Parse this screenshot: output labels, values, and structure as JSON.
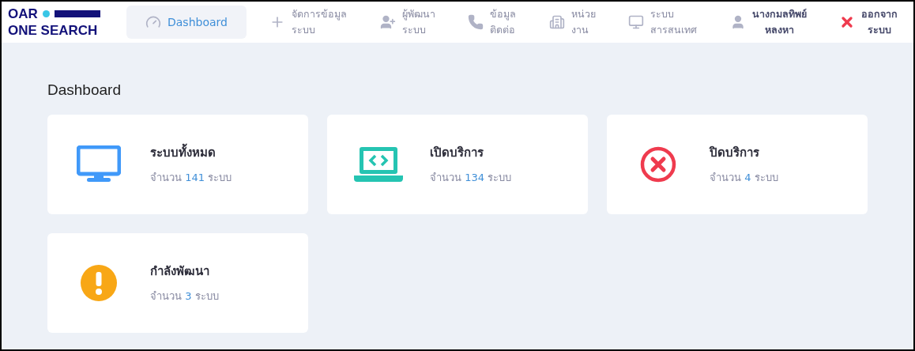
{
  "logo": {
    "line_1": "OAR",
    "line_2": "ONE SEARCH"
  },
  "nav": [
    {
      "kind": "dashboard",
      "lines": [
        "Dashboard"
      ],
      "selected": true
    },
    {
      "kind": "manage",
      "lines": [
        "จัดการข้อมูล",
        "ระบบ"
      ],
      "selected": false
    },
    {
      "kind": "developer",
      "lines": [
        "ผู้พัฒนา",
        "ระบบ"
      ],
      "selected": false
    },
    {
      "kind": "contact",
      "lines": [
        "ข้อมูล",
        "ติดต่อ"
      ],
      "selected": false
    },
    {
      "kind": "unit",
      "lines": [
        "หน่วย",
        "งาน"
      ],
      "selected": false
    },
    {
      "kind": "system",
      "lines": [
        "ระบบ",
        "สารสนเทศ"
      ],
      "selected": false
    },
    {
      "kind": "user",
      "lines": [
        "นางกมลทิพย์",
        "หลงหา"
      ],
      "selected": false
    },
    {
      "kind": "logout",
      "lines": [
        "ออกจาก",
        "ระบบ"
      ],
      "selected": false
    }
  ],
  "heading": "Dashboard",
  "cards": [
    {
      "kind": "all",
      "title": "ระบบทั้งหมด",
      "prefix": "จำนวน",
      "count": "141",
      "suffix": "ระบบ"
    },
    {
      "kind": "open",
      "title": "เปิดบริการ",
      "prefix": "จำนวน",
      "count": "134",
      "suffix": "ระบบ"
    },
    {
      "kind": "closed",
      "title": "ปิดบริการ",
      "prefix": "จำนวน",
      "count": "4",
      "suffix": "ระบบ"
    },
    {
      "kind": "developing",
      "title": "กำลังพัฒนา",
      "prefix": "จำนวน",
      "count": "3",
      "suffix": "ระบบ"
    }
  ]
}
